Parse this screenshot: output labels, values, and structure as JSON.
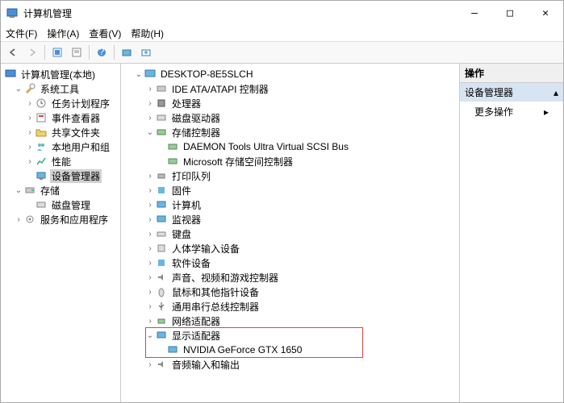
{
  "window": {
    "title": "计算机管理",
    "min": "—",
    "max": "□",
    "close": "✕"
  },
  "menu": {
    "file": "文件(F)",
    "action": "操作(A)",
    "view": "查看(V)",
    "help": "帮助(H)"
  },
  "left_tree": {
    "root": "计算机管理(本地)",
    "system_tools": "系统工具",
    "task_scheduler": "任务计划程序",
    "event_viewer": "事件查看器",
    "shared_folders": "共享文件夹",
    "local_users": "本地用户和组",
    "performance": "性能",
    "device_manager": "设备管理器",
    "storage": "存储",
    "disk_mgmt": "磁盘管理",
    "services": "服务和应用程序"
  },
  "mid_tree": {
    "computer": "DESKTOP-8E5SLCH",
    "ide": "IDE ATA/ATAPI 控制器",
    "cpu": "处理器",
    "disk_drives": "磁盘驱动器",
    "storage_ctrl": "存储控制器",
    "daemon": "DAEMON Tools Ultra Virtual SCSI Bus",
    "ms_storage": "Microsoft 存储空间控制器",
    "print_queue": "打印队列",
    "firmware": "固件",
    "computers": "计算机",
    "monitors": "监视器",
    "keyboards": "键盘",
    "hid": "人体学输入设备",
    "software": "软件设备",
    "sound": "声音、视频和游戏控制器",
    "mice": "鼠标和其他指针设备",
    "usb": "通用串行总线控制器",
    "network": "网络适配器",
    "display": "显示适配器",
    "gpu": "NVIDIA GeForce GTX 1650",
    "audio": "音频输入和输出"
  },
  "right": {
    "header": "操作",
    "section": "设备管理器",
    "more": "更多操作"
  }
}
